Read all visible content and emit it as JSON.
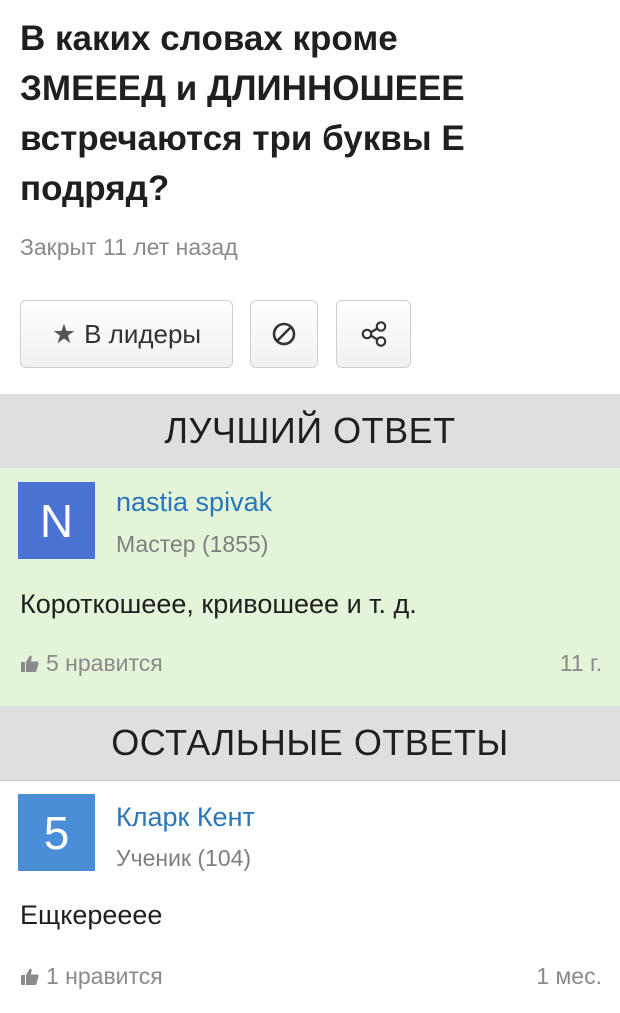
{
  "question": {
    "title_lines": [
      "В каких словах кроме",
      "ЗМЕЕЕД и ДЛИННОШЕЕЕ",
      "встречаются три буквы Е",
      "подряд?"
    ],
    "status": "Закрыт 11 лет назад"
  },
  "actions": {
    "leaders_label": "В лидеры",
    "star_icon": "star-icon",
    "block_icon": "block-icon",
    "share_icon": "share-icon"
  },
  "best_answer": {
    "header": "ЛУЧШИЙ ОТВЕТ",
    "avatar_letter": "N",
    "avatar_color": "#4a73d3",
    "author": "nastia spivak",
    "rank": "Мастер (1855)",
    "text": "Короткошеее, кривошеее и т. д.",
    "likes": "5 нравится",
    "age": "11 г.",
    "background": "#e3f4d8"
  },
  "other_answers": {
    "header": "ОСТАЛЬНЫЕ ОТВЕТЫ",
    "items": [
      {
        "avatar_letter": "5",
        "avatar_color": "#4a8ed8",
        "author": "Кларк Кент",
        "rank": "Ученик (104)",
        "text": "Ещкереееe",
        "likes": "1 нравится",
        "age": "1 мес."
      }
    ]
  }
}
